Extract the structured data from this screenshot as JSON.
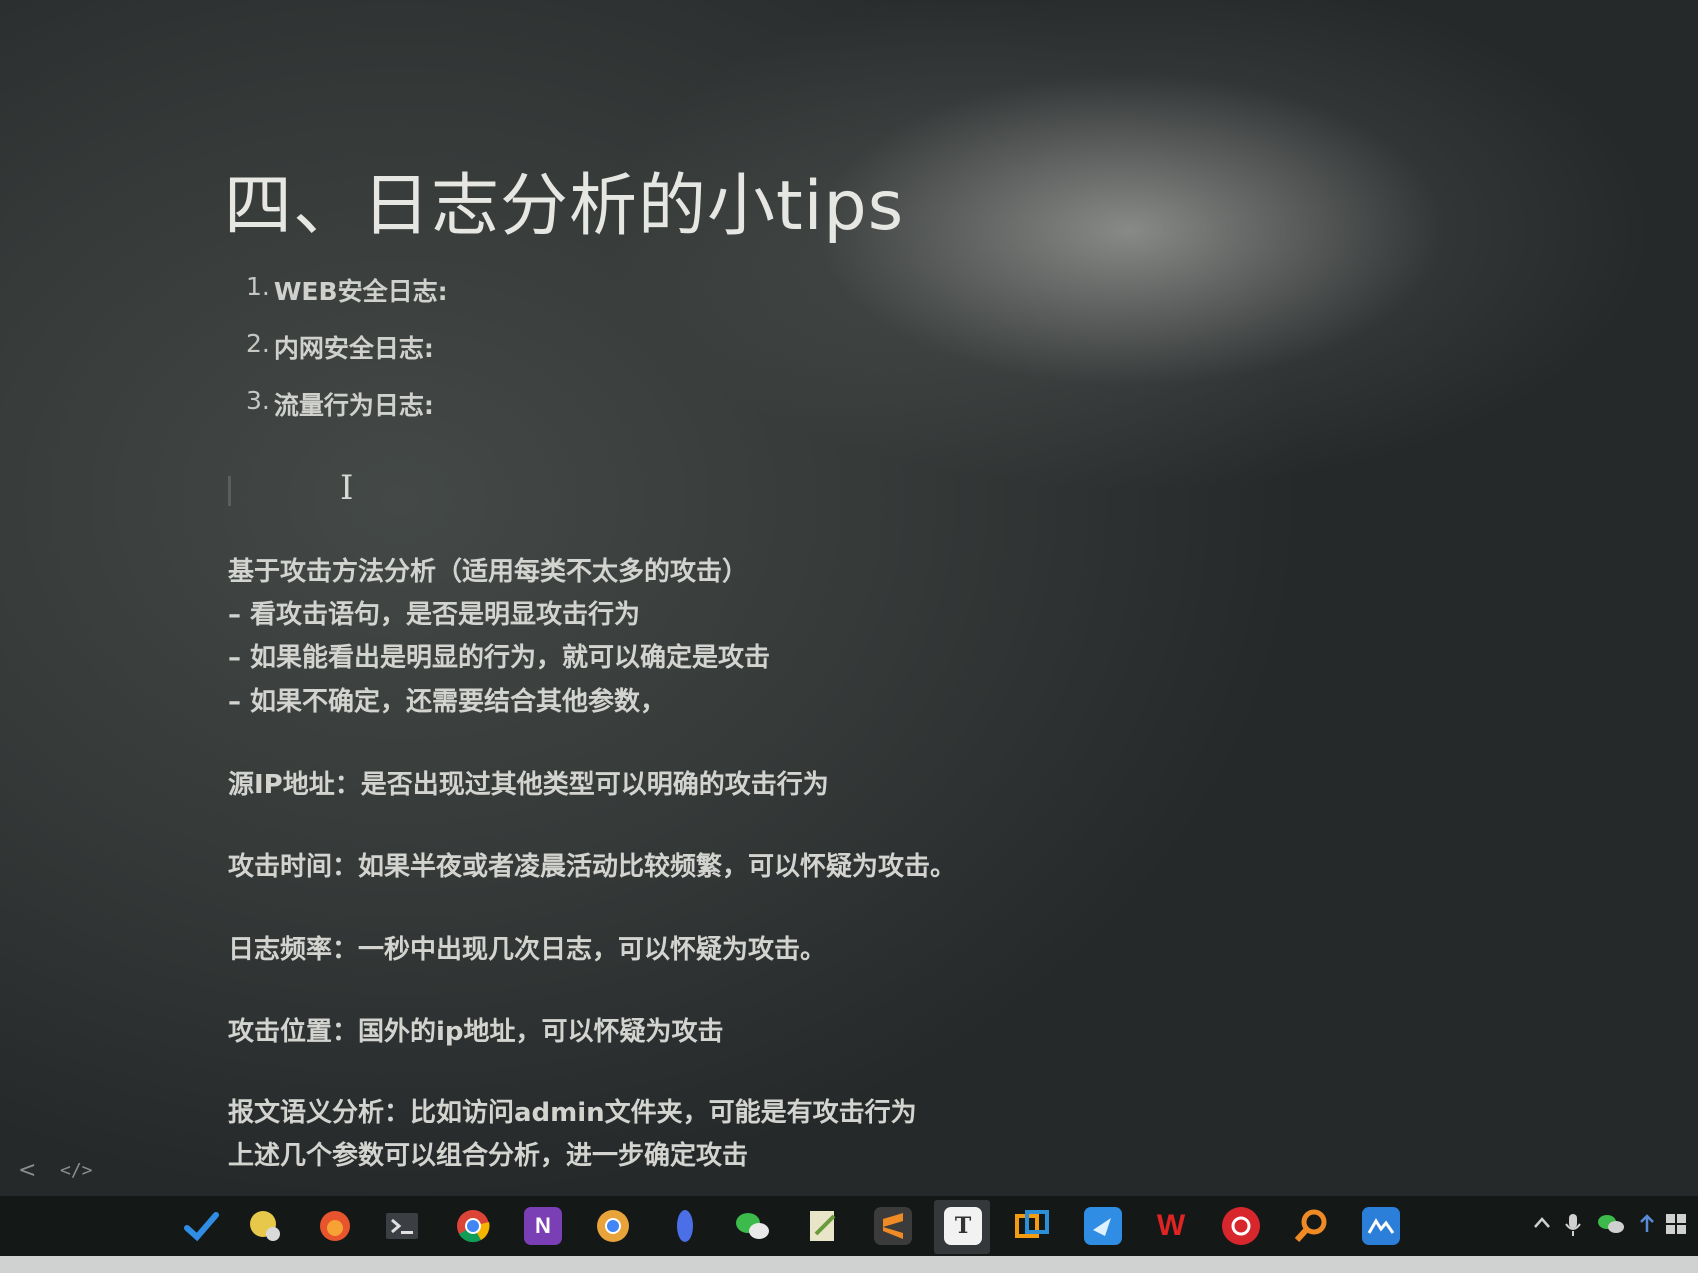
{
  "document": {
    "title": "四、日志分析的小tips",
    "toc": [
      {
        "num": "1.",
        "label": "WEB安全日志:"
      },
      {
        "num": "2.",
        "label": "内网安全日志:"
      },
      {
        "num": "3.",
        "label": "流量行为日志:"
      }
    ],
    "paragraphs": [
      "基于攻击方法分析（适用每类不太多的攻击）",
      "– 看攻击语句，是否是明显攻击行为",
      "– 如果能看出是明显的行为，就可以确定是攻击",
      "– 如果不确定，还需要结合其他参数，",
      "源IP地址：是否出现过其他类型可以明确的攻击行为",
      "攻击时间：如果半夜或者凌晨活动比较频繁，可以怀疑为攻击。",
      "日志频率：一秒中出现几次日志，可以怀疑为攻击。",
      "攻击位置：国外的ip地址，可以怀疑为攻击",
      "报文语义分析：比如访问admin文件夹，可能是有攻击行为",
      "上述几个参数可以组合分析，进一步确定攻击"
    ]
  },
  "statusbar": {
    "nav_glyph": "<",
    "code_glyph": "</>"
  },
  "taskbar": {
    "typora_letter": "T",
    "wps_letter": "W",
    "onenote_letter": "N",
    "icons": [
      "check-icon",
      "ball-icon",
      "firefox-icon",
      "terminal-icon",
      "chrome-icon",
      "onenote-icon",
      "chrome-alt-icon",
      "feather-icon",
      "wechat-icon",
      "notepad-icon",
      "sublime-icon",
      "typora-icon",
      "vmware-icon",
      "feishu-icon",
      "wps-icon",
      "netease-music-icon",
      "search-tool-icon",
      "app-icon"
    ]
  },
  "colors": {
    "background": "#2a2d2c",
    "text": "#d9dad6",
    "taskbar": "#141817"
  }
}
